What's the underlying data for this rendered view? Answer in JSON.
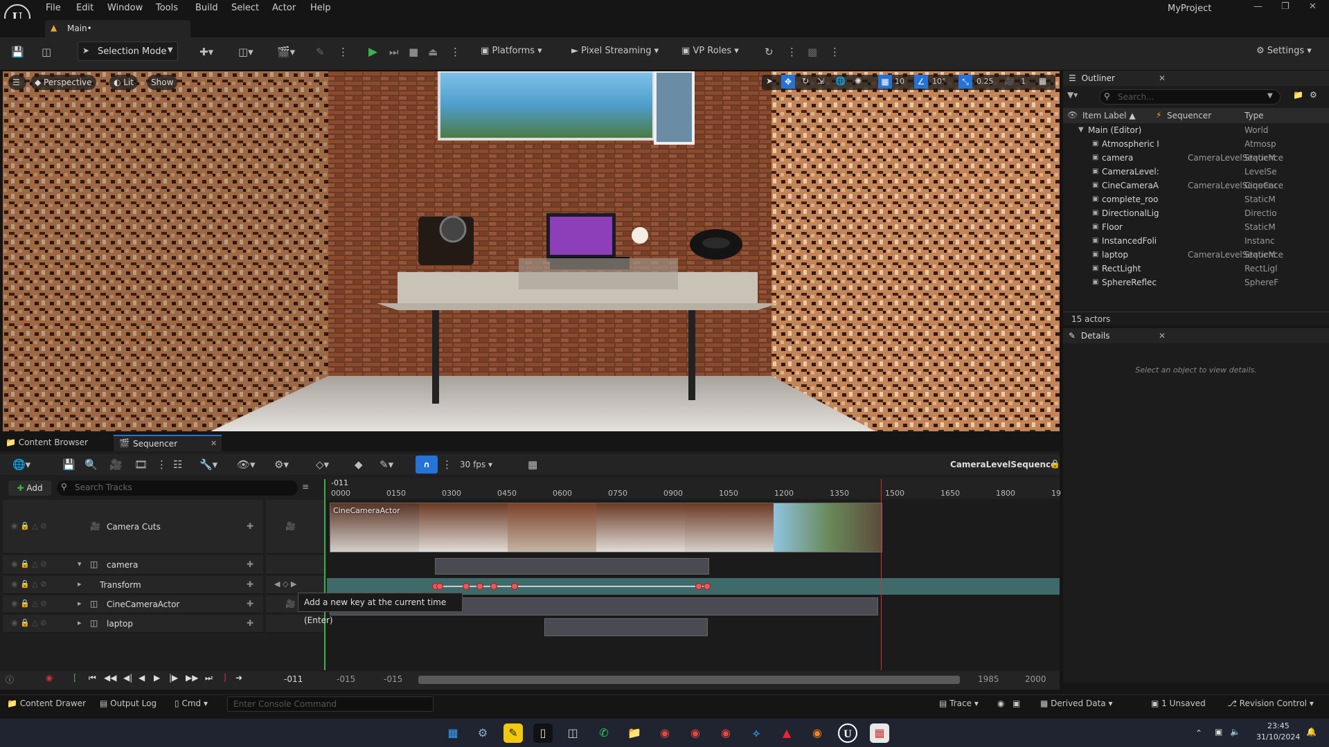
{
  "app": {
    "logo_text": "U",
    "project": "MyProject"
  },
  "menu": [
    "File",
    "Edit",
    "Window",
    "Tools",
    "Build",
    "Select",
    "Actor",
    "Help"
  ],
  "level_tab": "Main•",
  "toolbar": {
    "selection_mode": "Selection Mode",
    "platforms": "Platforms",
    "pixel_streaming": "Pixel Streaming",
    "vp_roles": "VP Roles",
    "settings": "Settings"
  },
  "viewport": {
    "perspective": "Perspective",
    "lit": "Lit",
    "show": "Show",
    "grid_snap": "10",
    "rotation_snap": "10°",
    "scale_snap": "0.25",
    "camera_speed": "1"
  },
  "outliner": {
    "title": "Outliner",
    "search_placeholder": "Search...",
    "columns": [
      "Item Label ▲",
      "Sequencer",
      "Type"
    ],
    "rows": [
      {
        "label": "Main (Editor)",
        "sequencer": "",
        "type": "World"
      },
      {
        "label": "Atmospheric I",
        "sequencer": "",
        "type": "Atmosp"
      },
      {
        "label": "camera",
        "sequencer": "CameraLevelSequence",
        "type": "StaticM"
      },
      {
        "label": "CameraLevel:",
        "sequencer": "",
        "type": "LevelSe"
      },
      {
        "label": "CineCameraA",
        "sequencer": "CameraLevelSequence",
        "type": "CineCar"
      },
      {
        "label": "complete_roo",
        "sequencer": "",
        "type": "StaticM"
      },
      {
        "label": "DirectionalLig",
        "sequencer": "",
        "type": "Directio"
      },
      {
        "label": "Floor",
        "sequencer": "",
        "type": "StaticM"
      },
      {
        "label": "InstancedFoli",
        "sequencer": "",
        "type": "Instanc"
      },
      {
        "label": "laptop",
        "sequencer": "CameraLevelSequence",
        "type": "StaticM"
      },
      {
        "label": "RectLight",
        "sequencer": "",
        "type": "RectLigl"
      },
      {
        "label": "SphereReflec",
        "sequencer": "",
        "type": "SphereF"
      }
    ],
    "count": "15 actors"
  },
  "details": {
    "title": "Details",
    "empty": "Select an object to view details."
  },
  "bottom_tabs": {
    "content_browser": "Content Browser",
    "sequencer": "Sequencer"
  },
  "sequencer": {
    "fps": "30 fps",
    "sequence_name": "CameraLevelSequence",
    "add": "Add",
    "search_placeholder": "Search Tracks",
    "current_frame": "-011",
    "ruler": [
      "0000",
      "0150",
      "0300",
      "0450",
      "0600",
      "0750",
      "0900",
      "1050",
      "1200",
      "1350",
      "1500",
      "1650",
      "1800",
      "19"
    ],
    "tracks": [
      {
        "name": "Camera Cuts",
        "kind": "cuts"
      },
      {
        "name": "camera",
        "kind": "actor"
      },
      {
        "name": "Transform",
        "kind": "sub"
      },
      {
        "name": "CineCameraActor",
        "kind": "actor"
      },
      {
        "name": "laptop",
        "kind": "actor"
      }
    ],
    "shot_label": "CineCameraActor",
    "tooltip": "Add a new key at the current time (Enter)",
    "playback_frame": "-011",
    "range_start_a": "-015",
    "range_start_b": "-015",
    "range_end_a": "1985",
    "range_end_b": "2000"
  },
  "statusbar": {
    "content_drawer": "Content Drawer",
    "output_log": "Output Log",
    "cmd": "Cmd",
    "console_placeholder": "Enter Console Command",
    "trace": "Trace",
    "derived_data": "Derived Data",
    "unsaved": "1 Unsaved",
    "revision_control": "Revision Control"
  },
  "taskbar": {
    "time": "23:45",
    "date": "31/10/2024"
  }
}
